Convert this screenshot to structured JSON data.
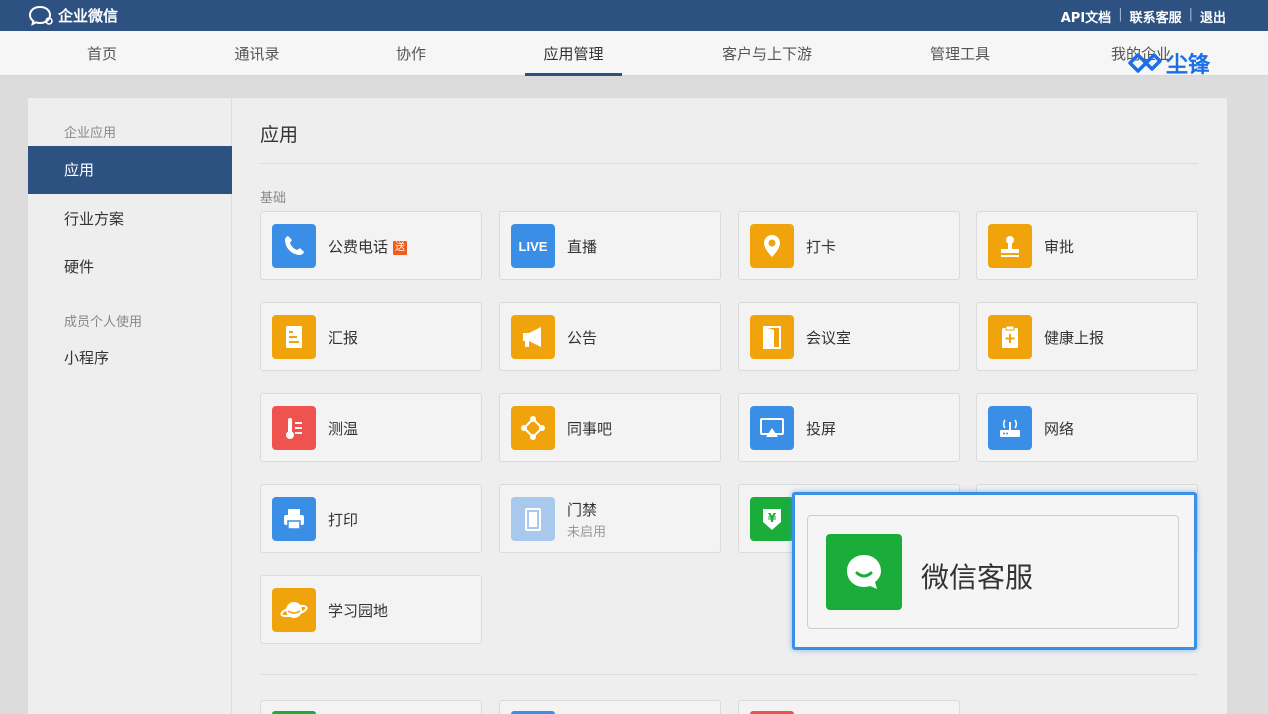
{
  "app": {
    "title": "企业微信"
  },
  "toplinks": [
    {
      "label": "API文档"
    },
    {
      "label": "联系客服"
    },
    {
      "label": "退出"
    }
  ],
  "nav": [
    {
      "label": "首页"
    },
    {
      "label": "通讯录"
    },
    {
      "label": "协作"
    },
    {
      "label": "应用管理",
      "active": true
    },
    {
      "label": "客户与上下游"
    },
    {
      "label": "管理工具"
    },
    {
      "label": "我的企业"
    }
  ],
  "watermark": {
    "text": "尘锋"
  },
  "sidebar": {
    "group1": "企业应用",
    "items1": [
      {
        "label": "应用",
        "active": true
      },
      {
        "label": "行业方案"
      },
      {
        "label": "硬件"
      }
    ],
    "group2": "成员个人使用",
    "items2": [
      {
        "label": "小程序"
      }
    ]
  },
  "content": {
    "title": "应用",
    "section": "基础",
    "apps": [
      {
        "name": "公费电话",
        "badge": "送",
        "icon": "phone-icon",
        "color": "#3a8ee6"
      },
      {
        "name": "直播",
        "icon": "live-icon",
        "color": "#3a8ee6"
      },
      {
        "name": "打卡",
        "icon": "location-pin-icon",
        "color": "#f0a30a"
      },
      {
        "name": "审批",
        "icon": "stamp-icon",
        "color": "#f0a30a"
      },
      {
        "name": "汇报",
        "icon": "report-icon",
        "color": "#f0a30a"
      },
      {
        "name": "公告",
        "icon": "megaphone-icon",
        "color": "#f0a30a"
      },
      {
        "name": "会议室",
        "icon": "door-icon",
        "color": "#f0a30a"
      },
      {
        "name": "健康上报",
        "icon": "health-clipboard-icon",
        "color": "#f0a30a"
      },
      {
        "name": "测温",
        "icon": "thermometer-icon",
        "color": "#ef5350"
      },
      {
        "name": "同事吧",
        "icon": "network-nodes-icon",
        "color": "#f0a30a"
      },
      {
        "name": "投屏",
        "icon": "screen-cast-icon",
        "color": "#3a8ee6"
      },
      {
        "name": "网络",
        "icon": "router-icon",
        "color": "#3a8ee6"
      },
      {
        "name": "打印",
        "icon": "printer-icon",
        "color": "#3a8ee6"
      },
      {
        "name": "门禁",
        "sub": "未启用",
        "icon": "door-access-icon",
        "color": "#a9c8ee"
      },
      {
        "name": "",
        "icon": "yuan-shield-icon",
        "color": "#1aad3a"
      },
      {
        "name": "学习园地",
        "icon": "planet-icon",
        "color": "#f0a30a"
      }
    ]
  },
  "popup": {
    "name": "微信客服",
    "icon": "chat-bubble-icon",
    "color": "#1aad3a"
  }
}
